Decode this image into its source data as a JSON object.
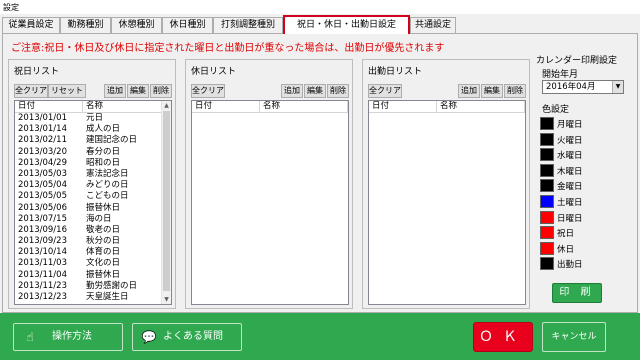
{
  "window": {
    "title": "設定"
  },
  "tabs": [
    {
      "label": "従業員設定"
    },
    {
      "label": "勤務種別"
    },
    {
      "label": "休憩種別"
    },
    {
      "label": "休日種別"
    },
    {
      "label": "打刻調整種別"
    },
    {
      "label": "祝日・休日・出勤日設定"
    },
    {
      "label": "共通設定"
    }
  ],
  "notice": "ご注意:祝日・休日及び休日に指定された曜日と出勤日が重なった場合は、出勤日が優先されます",
  "holiday_list": {
    "title": "祝日リスト",
    "buttons": {
      "clear": "全クリア",
      "reset": "リセット",
      "add": "追加",
      "edit": "編集",
      "delete": "削除"
    },
    "columns": {
      "date": "日付",
      "name": "名称"
    },
    "rows": [
      {
        "date": "2013/01/01",
        "name": "元日"
      },
      {
        "date": "2013/01/14",
        "name": "成人の日"
      },
      {
        "date": "2013/02/11",
        "name": "建国記念の日"
      },
      {
        "date": "2013/03/20",
        "name": "春分の日"
      },
      {
        "date": "2013/04/29",
        "name": "昭和の日"
      },
      {
        "date": "2013/05/03",
        "name": "憲法記念日"
      },
      {
        "date": "2013/05/04",
        "name": "みどりの日"
      },
      {
        "date": "2013/05/05",
        "name": "こどもの日"
      },
      {
        "date": "2013/05/06",
        "name": "振替休日"
      },
      {
        "date": "2013/07/15",
        "name": "海の日"
      },
      {
        "date": "2013/09/16",
        "name": "敬老の日"
      },
      {
        "date": "2013/09/23",
        "name": "秋分の日"
      },
      {
        "date": "2013/10/14",
        "name": "体育の日"
      },
      {
        "date": "2013/11/03",
        "name": "文化の日"
      },
      {
        "date": "2013/11/04",
        "name": "振替休日"
      },
      {
        "date": "2013/11/23",
        "name": "勤労感謝の日"
      },
      {
        "date": "2013/12/23",
        "name": "天皇誕生日"
      }
    ]
  },
  "dayoff_list": {
    "title": "休日リスト",
    "buttons": {
      "clear": "全クリア",
      "add": "追加",
      "edit": "編集",
      "delete": "削除"
    },
    "columns": {
      "date": "日付",
      "name": "名称"
    }
  },
  "workday_list": {
    "title": "出勤日リスト",
    "buttons": {
      "clear": "全クリア",
      "add": "追加",
      "edit": "編集",
      "delete": "削除"
    },
    "columns": {
      "date": "日付",
      "name": "名称"
    }
  },
  "calendar_print": {
    "title": "カレンダー印刷設定",
    "start_label": "開始年月",
    "start_value": "2016年04月",
    "color_title": "色設定",
    "colors": [
      {
        "label": "月曜日",
        "color": "#000000"
      },
      {
        "label": "火曜日",
        "color": "#000000"
      },
      {
        "label": "水曜日",
        "color": "#000000"
      },
      {
        "label": "木曜日",
        "color": "#000000"
      },
      {
        "label": "金曜日",
        "color": "#000000"
      },
      {
        "label": "土曜日",
        "color": "#0000ff"
      },
      {
        "label": "日曜日",
        "color": "#ff0000"
      },
      {
        "label": "祝日",
        "color": "#ff0000"
      },
      {
        "label": "休日",
        "color": "#ff0000"
      },
      {
        "label": "出勤日",
        "color": "#000000"
      }
    ],
    "print_label": "印 刷"
  },
  "footer": {
    "howto_label": "操作方法",
    "faq_label": "よくある質問",
    "ok_label": "ＯＫ",
    "cancel_label": "キャンセル"
  }
}
